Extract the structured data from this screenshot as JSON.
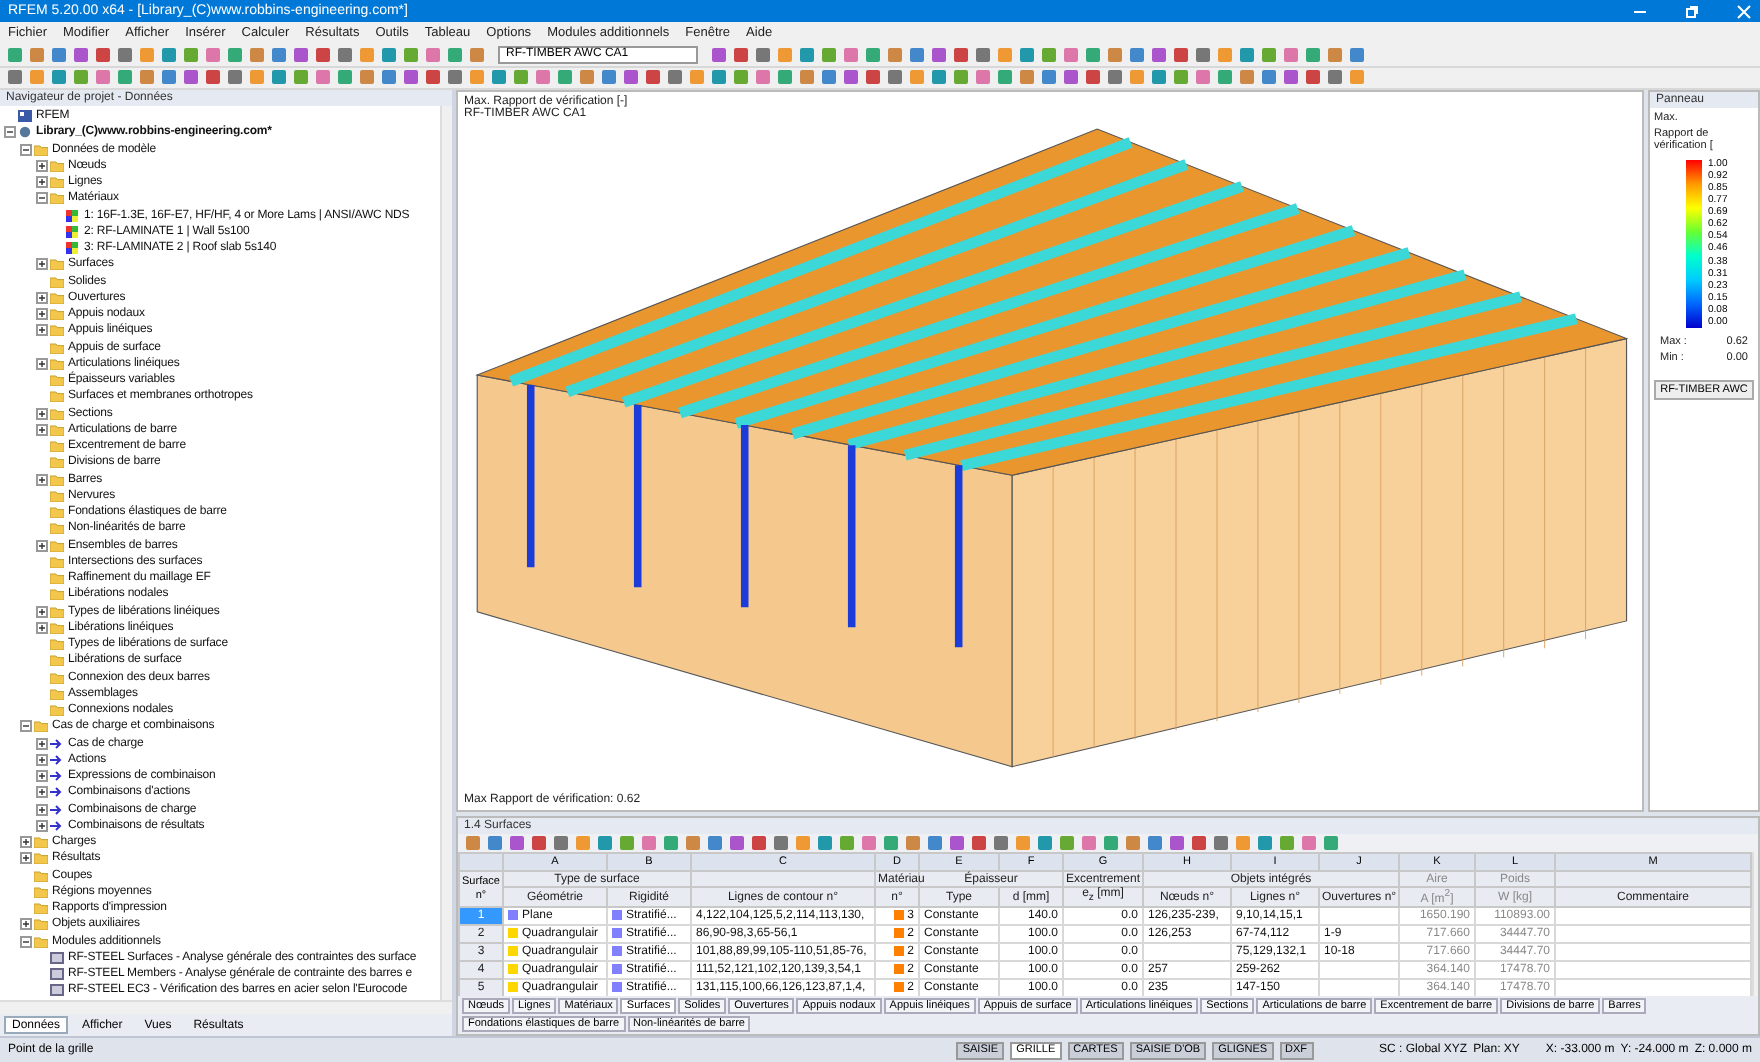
{
  "window": {
    "title": "RFEM 5.20.00 x64 - [Library_(C)www.robbins-engineering.com*]"
  },
  "menu": [
    "Fichier",
    "Modifier",
    "Afficher",
    "Insérer",
    "Calculer",
    "Résultats",
    "Outils",
    "Tableau",
    "Options",
    "Modules additionnels",
    "Fenêtre",
    "Aide"
  ],
  "toolbar": {
    "load_case_select": "RF-TIMBER AWC CA1"
  },
  "navigator": {
    "title": "Navigateur de projet - Données",
    "tree": [
      {
        "label": "RFEM",
        "kind": "app"
      },
      {
        "label": "Library_(C)www.robbins-engineering.com*",
        "kind": "file",
        "expanded": true,
        "children": [
          {
            "label": "Données de modèle",
            "expanded": true,
            "children": [
              {
                "label": "Nœuds",
                "expanded": false
              },
              {
                "label": "Lignes",
                "expanded": false
              },
              {
                "label": "Matériaux",
                "expanded": true,
                "children": [
                  {
                    "label": "1: 16F-1.3E, 16F-E7, HF/HF, 4 or More Lams | ANSI/AWC NDS",
                    "kind": "material"
                  },
                  {
                    "label": "2: RF-LAMINATE 1 | Wall 5s100",
                    "kind": "material"
                  },
                  {
                    "label": "3: RF-LAMINATE 2 | Roof slab 5s140",
                    "kind": "material"
                  }
                ]
              },
              {
                "label": "Surfaces",
                "expanded": false
              },
              {
                "label": "Solides"
              },
              {
                "label": "Ouvertures",
                "expanded": false
              },
              {
                "label": "Appuis nodaux",
                "expanded": false
              },
              {
                "label": "Appuis linéiques",
                "expanded": false
              },
              {
                "label": "Appuis de surface"
              },
              {
                "label": "Articulations linéiques",
                "expanded": false
              },
              {
                "label": "Épaisseurs variables"
              },
              {
                "label": "Surfaces et membranes orthotropes"
              },
              {
                "label": "Sections",
                "expanded": false
              },
              {
                "label": "Articulations de barre",
                "expanded": false
              },
              {
                "label": "Excentrement de barre"
              },
              {
                "label": "Divisions de barre"
              },
              {
                "label": "Barres",
                "expanded": false
              },
              {
                "label": "Nervures"
              },
              {
                "label": "Fondations élastiques de barre"
              },
              {
                "label": "Non-linéarités de barre"
              },
              {
                "label": "Ensembles de barres",
                "expanded": false
              },
              {
                "label": "Intersections des surfaces"
              },
              {
                "label": "Raffinement du maillage EF"
              },
              {
                "label": "Libérations nodales"
              },
              {
                "label": "Types de libérations linéiques",
                "expanded": false
              },
              {
                "label": "Libérations linéiques",
                "expanded": false
              },
              {
                "label": "Types de libérations de surface"
              },
              {
                "label": "Libérations de surface"
              },
              {
                "label": "Connexion des deux barres"
              },
              {
                "label": "Assemblages"
              },
              {
                "label": "Connexions nodales"
              }
            ]
          },
          {
            "label": "Cas de charge et combinaisons",
            "expanded": true,
            "children": [
              {
                "label": "Cas de charge",
                "expanded": false,
                "kind": "load"
              },
              {
                "label": "Actions",
                "expanded": false,
                "kind": "load"
              },
              {
                "label": "Expressions de combinaison",
                "expanded": false,
                "kind": "load"
              },
              {
                "label": "Combinaisons d'actions",
                "expanded": false,
                "kind": "load"
              },
              {
                "label": "Combinaisons de charge",
                "expanded": false,
                "kind": "load"
              },
              {
                "label": "Combinaisons de résultats",
                "expanded": false,
                "kind": "load"
              }
            ]
          },
          {
            "label": "Charges",
            "expanded": false
          },
          {
            "label": "Résultats",
            "expanded": false
          },
          {
            "label": "Coupes"
          },
          {
            "label": "Régions moyennes"
          },
          {
            "label": "Rapports d'impression"
          },
          {
            "label": "Objets auxiliaires",
            "expanded": false
          },
          {
            "label": "Modules additionnels",
            "expanded": true,
            "children": [
              {
                "label": "RF-STEEL Surfaces - Analyse générale des contraintes des surface",
                "kind": "module"
              },
              {
                "label": "RF-STEEL Members - Analyse générale de contrainte des barres e",
                "kind": "module"
              },
              {
                "label": "RF-STEEL EC3 - Vérification des barres en acier selon l'Eurocode",
                "kind": "module"
              }
            ]
          }
        ]
      }
    ],
    "tabs": [
      {
        "label": "Données",
        "selected": true
      },
      {
        "label": "Afficher",
        "selected": false
      },
      {
        "label": "Vues",
        "selected": false
      },
      {
        "label": "Résultats",
        "selected": false
      }
    ]
  },
  "viewport": {
    "result_title": "Max. Rapport de vérification [-]",
    "module_title": "RF-TIMBER AWC CA1",
    "footer": "Max Rapport de vérification: 0.62"
  },
  "panel": {
    "title": "Panneau",
    "heading": "Max.",
    "subheading": "Rapport de vérification [",
    "legend_values": [
      "1.00",
      "0.92",
      "0.85",
      "0.77",
      "0.69",
      "0.62",
      "0.54",
      "0.46",
      "0.38",
      "0.31",
      "0.23",
      "0.15",
      "0.08",
      "0.00"
    ],
    "max": "Max :",
    "max_value": "0.62",
    "min": "Min :",
    "min_value": "0.00",
    "button": "RF-TIMBER AWC"
  },
  "table": {
    "title": "1.4 Surfaces",
    "row_header": "Surface n°",
    "column_groups": [
      {
        "group": "Type de surface",
        "columns": [
          {
            "letter": "A",
            "label": "Géométrie"
          },
          {
            "letter": "B",
            "label": "Rigidité"
          }
        ]
      },
      {
        "columns": [
          {
            "letter": "C",
            "label": "Lignes de contour n°"
          }
        ]
      },
      {
        "group": "Matériau",
        "columns": [
          {
            "letter": "D",
            "label": "n°"
          }
        ]
      },
      {
        "group": "Épaisseur",
        "columns": [
          {
            "letter": "E",
            "label": "Type"
          },
          {
            "letter": "F",
            "label": "d [mm]"
          }
        ]
      },
      {
        "group": "Excentrement",
        "columns": [
          {
            "letter": "G",
            "label": "e$_{z}$ [mm]"
          }
        ]
      },
      {
        "group": "Objets intégrés",
        "columns": [
          {
            "letter": "H",
            "label": "Nœuds n°"
          },
          {
            "letter": "I",
            "label": "Lignes n°"
          },
          {
            "letter": "J",
            "label": "Ouvertures n°"
          }
        ]
      },
      {
        "group": "Aire",
        "computed": true,
        "columns": [
          {
            "letter": "K",
            "label": "A [m$^{2}$]"
          }
        ]
      },
      {
        "group": "Poids",
        "computed": true,
        "columns": [
          {
            "letter": "L",
            "label": "W [kg]"
          }
        ]
      },
      {
        "columns": [
          {
            "letter": "M",
            "label": "Commentaire"
          }
        ]
      }
    ],
    "rows": [
      {
        "number": "1",
        "selected": true,
        "cells": [
          {
            "text": "Plane",
            "color": "#8080ff"
          },
          {
            "text": "Stratifié...",
            "color": "#8080ff"
          },
          "4,122,104,125,5,2,114,113,130,",
          {
            "text": "3",
            "color": "#ff7f00"
          },
          "Constante",
          "140.0",
          "0.0",
          "126,235-239,",
          "9,10,14,15,1",
          "",
          "1650.190",
          "110893.00",
          ""
        ]
      },
      {
        "number": "2",
        "selected": false,
        "cells": [
          {
            "text": "Quadrangulair",
            "color": "#ffd700"
          },
          {
            "text": "Stratifié...",
            "color": "#8080ff"
          },
          "86,90-98,3,65-56,1",
          {
            "text": "2",
            "color": "#ff7f00"
          },
          "Constante",
          "100.0",
          "0.0",
          "126,253",
          "67-74,112",
          "1-9",
          "717.660",
          "34447.70",
          ""
        ]
      },
      {
        "number": "3",
        "selected": false,
        "cells": [
          {
            "text": "Quadrangulair",
            "color": "#ffd700"
          },
          {
            "text": "Stratifié...",
            "color": "#8080ff"
          },
          "101,88,89,99,105-110,51,85-76,",
          {
            "text": "2",
            "color": "#ff7f00"
          },
          "Constante",
          "100.0",
          "0.0",
          "",
          "75,129,132,1",
          "10-18",
          "717.660",
          "34447.70",
          ""
        ]
      },
      {
        "number": "4",
        "selected": false,
        "cells": [
          {
            "text": "Quadrangulair",
            "color": "#ffd700"
          },
          {
            "text": "Stratifié...",
            "color": "#8080ff"
          },
          "111,52,121,102,120,139,3,54,1",
          {
            "text": "2",
            "color": "#ff7f00"
          },
          "Constante",
          "100.0",
          "0.0",
          "257",
          "259-262",
          "",
          "364.140",
          "17478.70",
          ""
        ]
      },
      {
        "number": "5",
        "selected": false,
        "cells": [
          {
            "text": "Quadrangulair",
            "color": "#ffd700"
          },
          {
            "text": "Stratifié...",
            "color": "#8080ff"
          },
          "131,115,100,66,126,123,87,1,4,",
          {
            "text": "2",
            "color": "#ff7f00"
          },
          "Constante",
          "100.0",
          "0.0",
          "235",
          "147-150",
          "",
          "364.140",
          "17478.70",
          ""
        ]
      }
    ],
    "tabs": [
      {
        "label": "Nœuds",
        "selected": false
      },
      {
        "label": "Lignes",
        "selected": false
      },
      {
        "label": "Matériaux",
        "selected": false
      },
      {
        "label": "Surfaces",
        "selected": true
      },
      {
        "label": "Solides",
        "selected": false
      },
      {
        "label": "Ouvertures",
        "selected": false
      },
      {
        "label": "Appuis nodaux",
        "selected": false
      },
      {
        "label": "Appuis linéiques",
        "selected": false
      },
      {
        "label": "Appuis de surface",
        "selected": false
      },
      {
        "label": "Articulations linéiques",
        "selected": false
      },
      {
        "label": "Sections",
        "selected": false
      },
      {
        "label": "Articulations de barre",
        "selected": false
      },
      {
        "label": "Excentrement de barre",
        "selected": false
      },
      {
        "label": "Divisions de barre",
        "selected": false
      },
      {
        "label": "Barres",
        "selected": false
      },
      {
        "label": "Fondations élastiques de barre",
        "selected": false
      },
      {
        "label": "Non-linéarités de barre",
        "selected": false
      }
    ]
  },
  "status_bar": {
    "hint": "Point de la grille",
    "toggles": [
      {
        "label": "SAISIE",
        "on": false
      },
      {
        "label": "GRILLE",
        "on": true
      },
      {
        "label": "CARTES",
        "on": false
      },
      {
        "label": "SAISIE D'OB",
        "on": false
      },
      {
        "label": "GLIGNES",
        "on": false
      },
      {
        "label": "DXF",
        "on": false
      }
    ],
    "coordinate_system": "SC : Global XYZ",
    "plane": "Plan: XY",
    "x": "X: -33.000 m",
    "y": "Y: -24.000 m",
    "z": "Z: 0.000 m"
  }
}
